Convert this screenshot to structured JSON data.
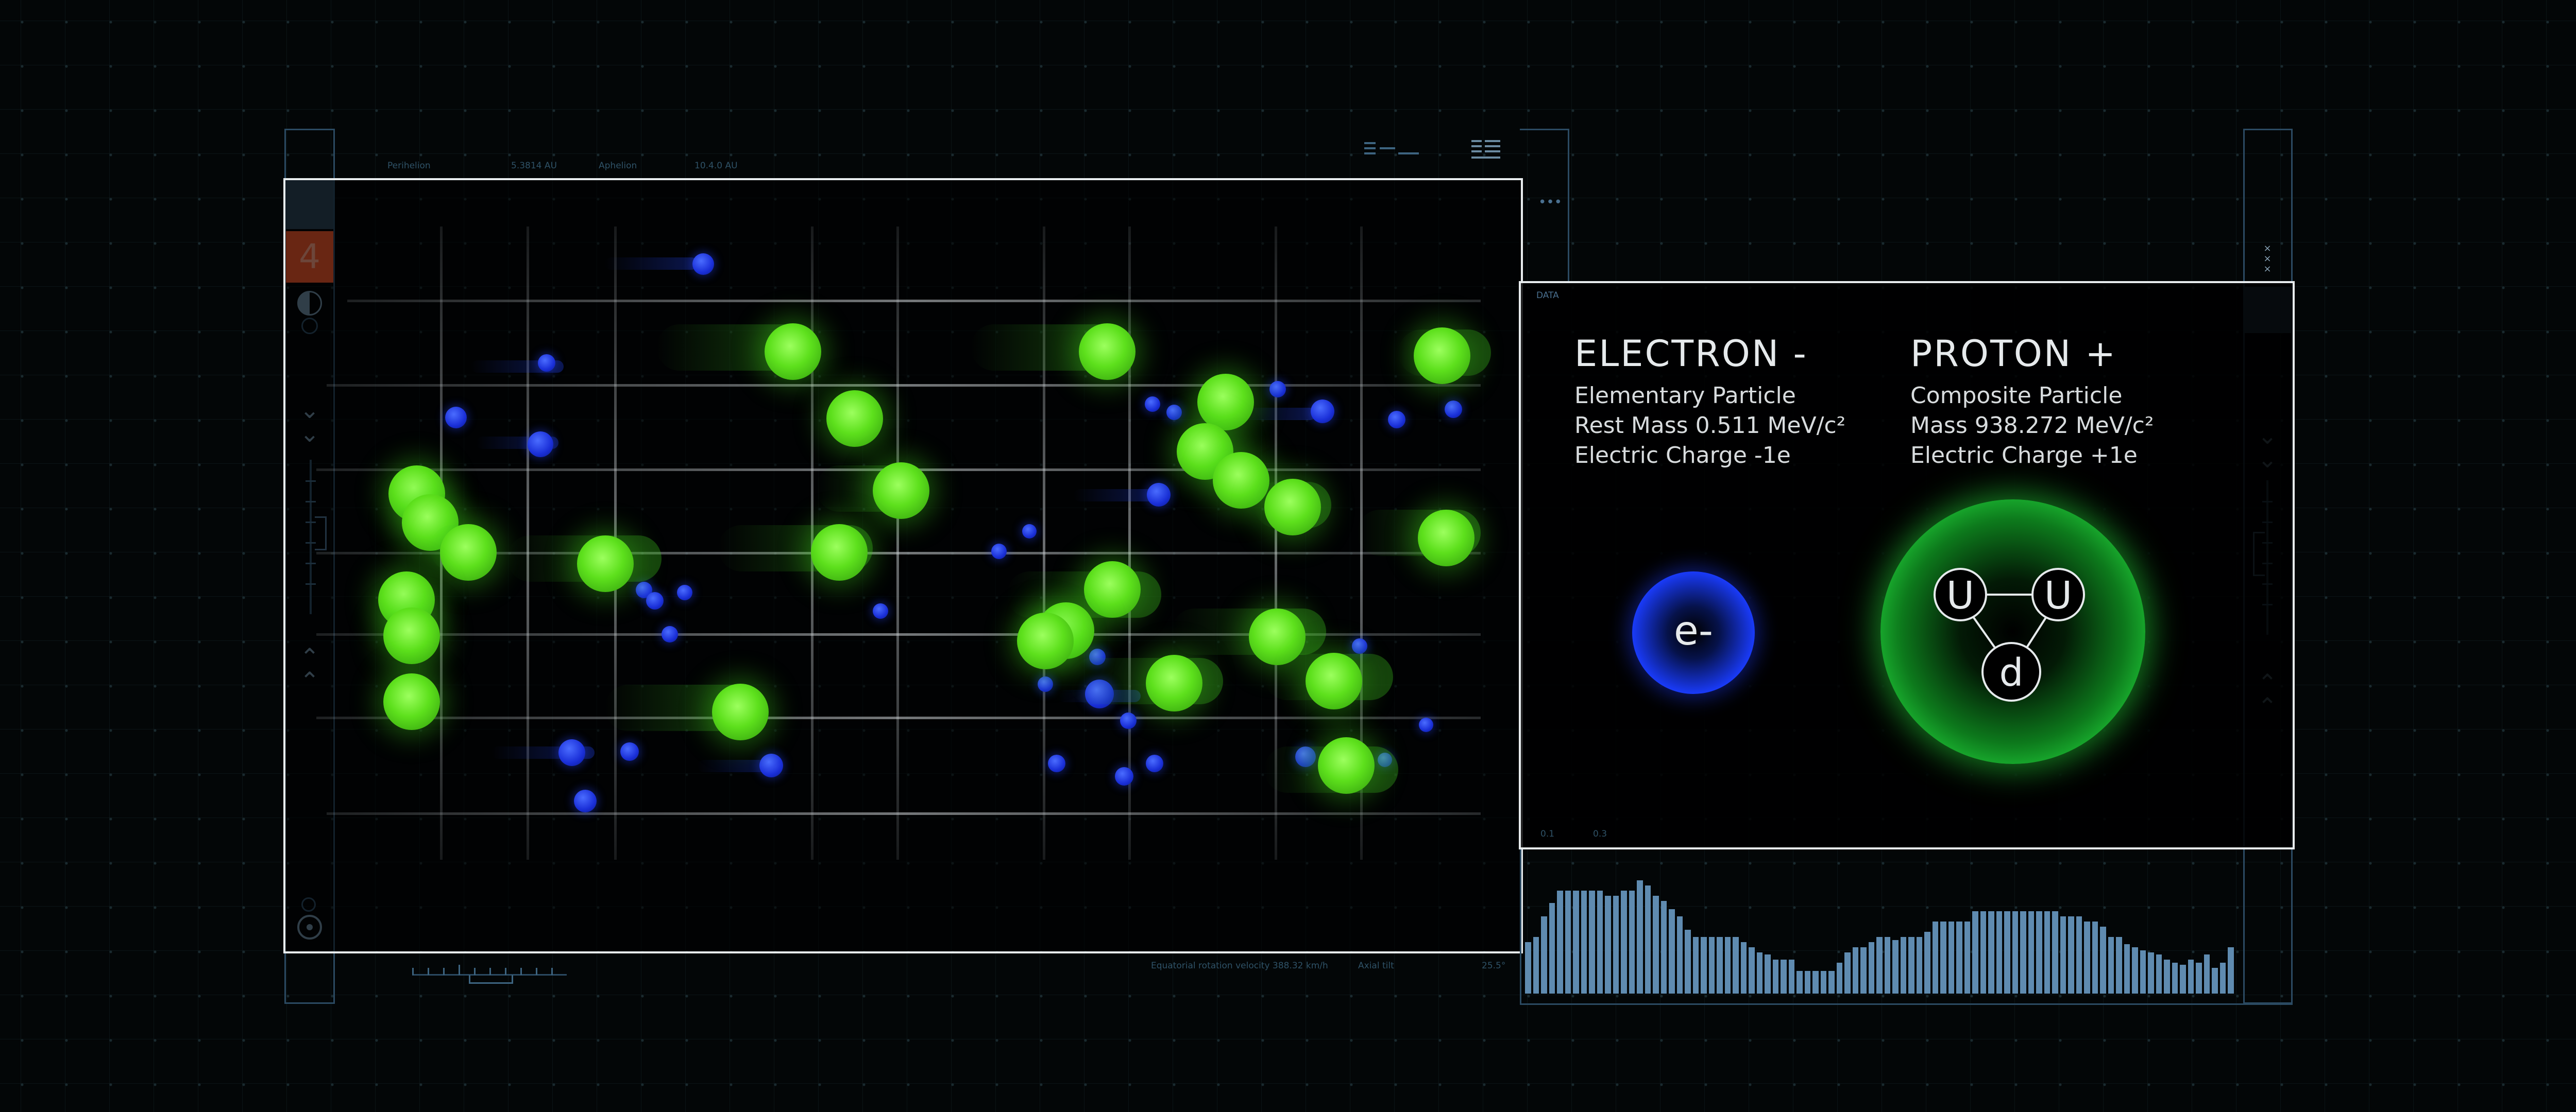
{
  "viewport": {
    "label": "4"
  },
  "header": {
    "left_readouts": [
      "Perihelion",
      "5.3814 AU",
      "Aphelion",
      "10.4.0 AU"
    ],
    "right_icons": [
      "list-icon",
      "menu-icon"
    ]
  },
  "footer": {
    "readouts": [
      "Equatorial rotation velocity",
      "388.32 km/h",
      "Axial tilt",
      "25.5°"
    ]
  },
  "side_panel": {
    "tag": "DATA",
    "menu_dots": "•••",
    "close_mark": "× × ×"
  },
  "electron": {
    "title": "ELECTRON -",
    "line1": "Elementary Particle",
    "line2": "Rest Mass 0.511 MeV/c²",
    "line3": "Electric Charge -1e",
    "symbol": "e-"
  },
  "proton": {
    "title": "PROTON +",
    "line1": "Composite Particle",
    "line2": "Mass 938.272 MeV/c²",
    "line3": "Electric Charge +1e",
    "quarks": [
      "U",
      "U",
      "d"
    ]
  },
  "histogram": {
    "labels": [
      "0.1",
      "0.3"
    ],
    "values": [
      0.5,
      0.55,
      0.75,
      0.88,
      1,
      1,
      1,
      1,
      1,
      1,
      0.95,
      0.95,
      1,
      1,
      1.1,
      1.05,
      0.95,
      0.9,
      0.82,
      0.75,
      0.62,
      0.55,
      0.55,
      0.55,
      0.55,
      0.55,
      0.55,
      0.5,
      0.45,
      0.4,
      0.38,
      0.33,
      0.33,
      0.33,
      0.22,
      0.22,
      0.22,
      0.22,
      0.22,
      0.3,
      0.4,
      0.45,
      0.45,
      0.5,
      0.55,
      0.55,
      0.52,
      0.55,
      0.55,
      0.55,
      0.6,
      0.7,
      0.7,
      0.7,
      0.7,
      0.7,
      0.8,
      0.8,
      0.8,
      0.8,
      0.8,
      0.8,
      0.8,
      0.8,
      0.8,
      0.8,
      0.8,
      0.75,
      0.75,
      0.75,
      0.7,
      0.7,
      0.65,
      0.55,
      0.55,
      0.48,
      0.45,
      0.42,
      0.4,
      0.38,
      0.33,
      0.3,
      0.28,
      0.33,
      0.3,
      0.38,
      0.25,
      0.3,
      0.45
    ],
    "color": "#5f8bb0"
  },
  "colors": {
    "accent_orange": "#e8542a",
    "green": "#5de01c",
    "blue": "#1a2fd8",
    "rail": "#2b4a62"
  }
}
